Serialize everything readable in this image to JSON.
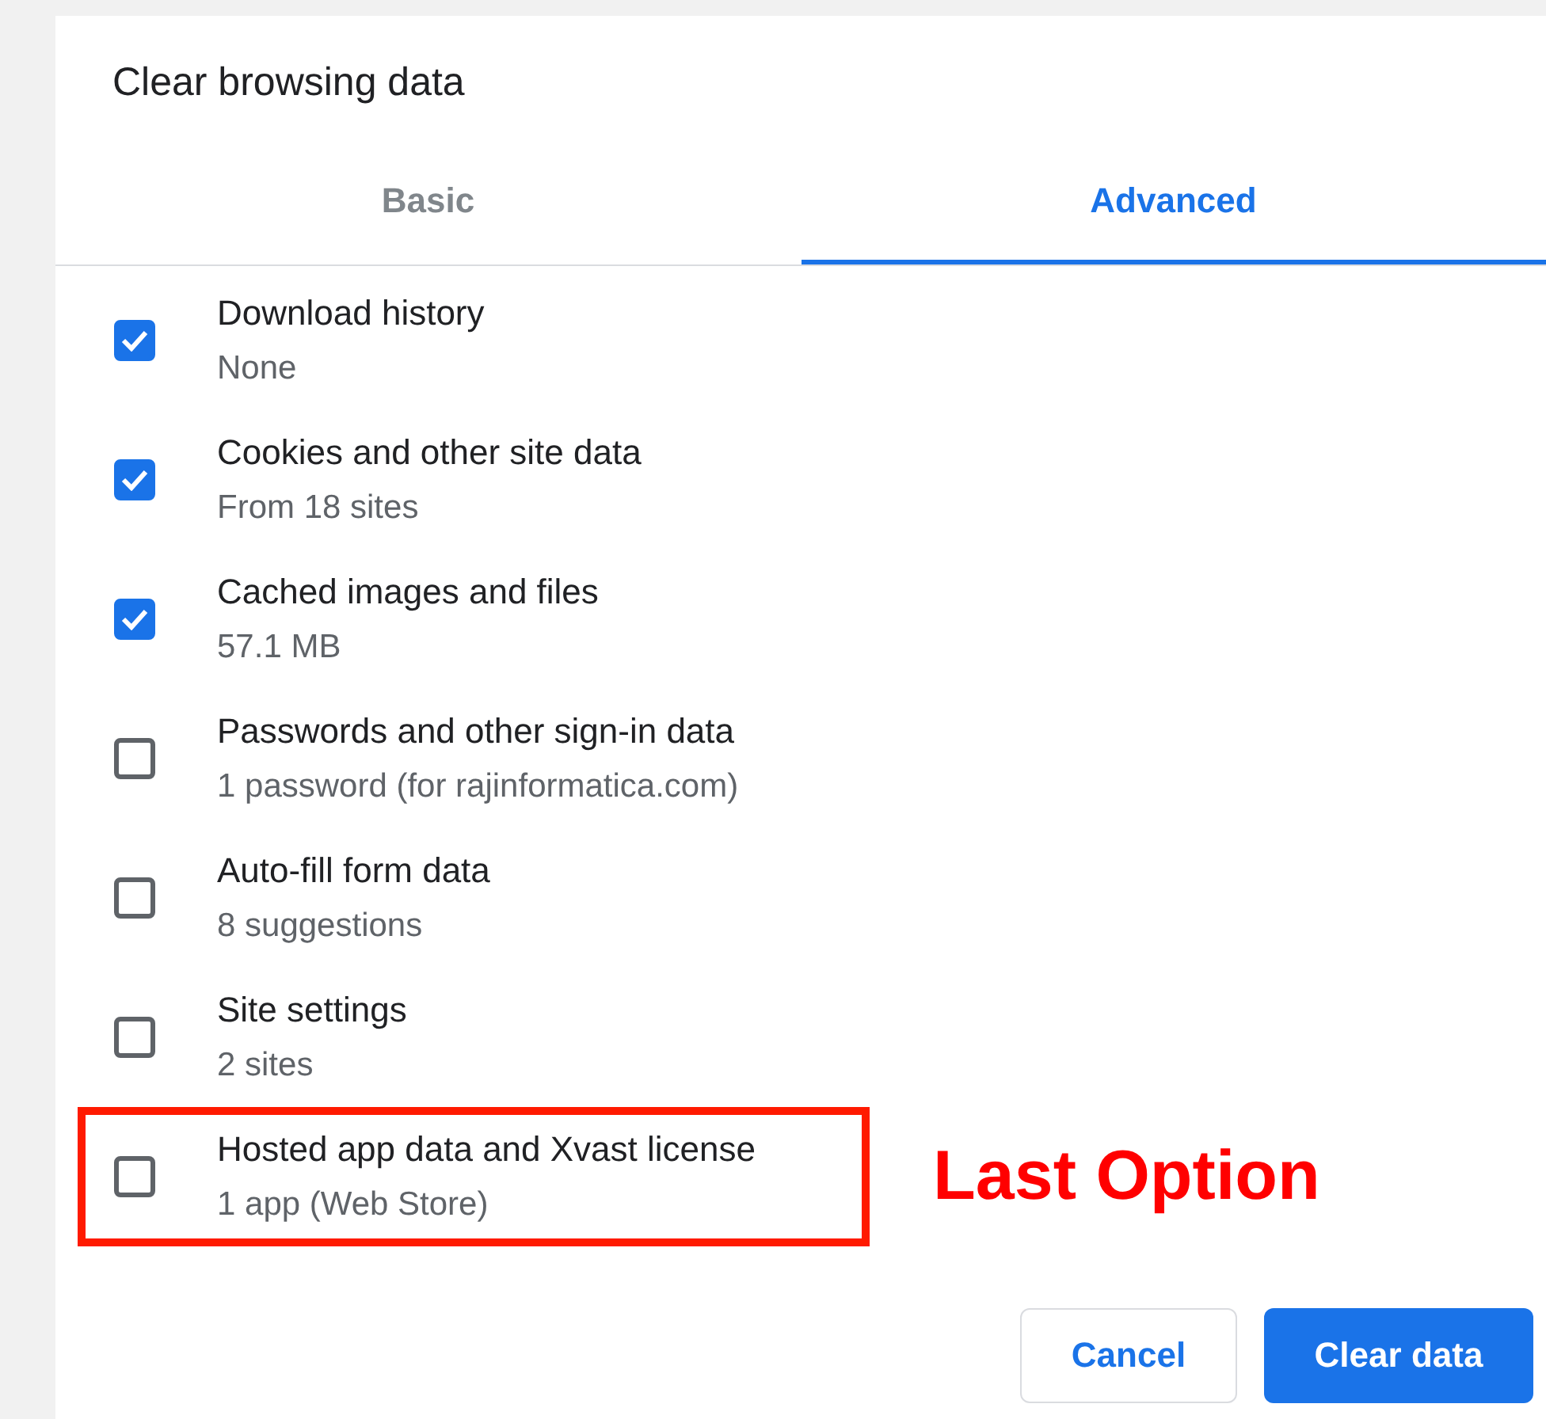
{
  "dialog": {
    "title": "Clear browsing data"
  },
  "tabs": [
    {
      "label": "Basic",
      "selected": false
    },
    {
      "label": "Advanced",
      "selected": true
    }
  ],
  "items": [
    {
      "label": "Download history",
      "detail": "None",
      "checked": true,
      "highlighted": false
    },
    {
      "label": "Cookies and other site data",
      "detail": "From 18 sites",
      "checked": true,
      "highlighted": false
    },
    {
      "label": "Cached images and files",
      "detail": "57.1 MB",
      "checked": true,
      "highlighted": false
    },
    {
      "label": "Passwords and other sign-in data",
      "detail": "1 password (for rajinformatica.com)",
      "checked": false,
      "highlighted": false
    },
    {
      "label": "Auto-fill form data",
      "detail": "8 suggestions",
      "checked": false,
      "highlighted": false
    },
    {
      "label": "Site settings",
      "detail": "2 sites",
      "checked": false,
      "highlighted": false
    },
    {
      "label": "Hosted app data and Xvast license",
      "detail": "1 app (Web Store)",
      "checked": false,
      "highlighted": true,
      "annotation": "Last Option"
    }
  ],
  "buttons": [
    {
      "label": "Cancel",
      "kind": "secondary"
    },
    {
      "label": "Clear data",
      "kind": "primary"
    }
  ]
}
